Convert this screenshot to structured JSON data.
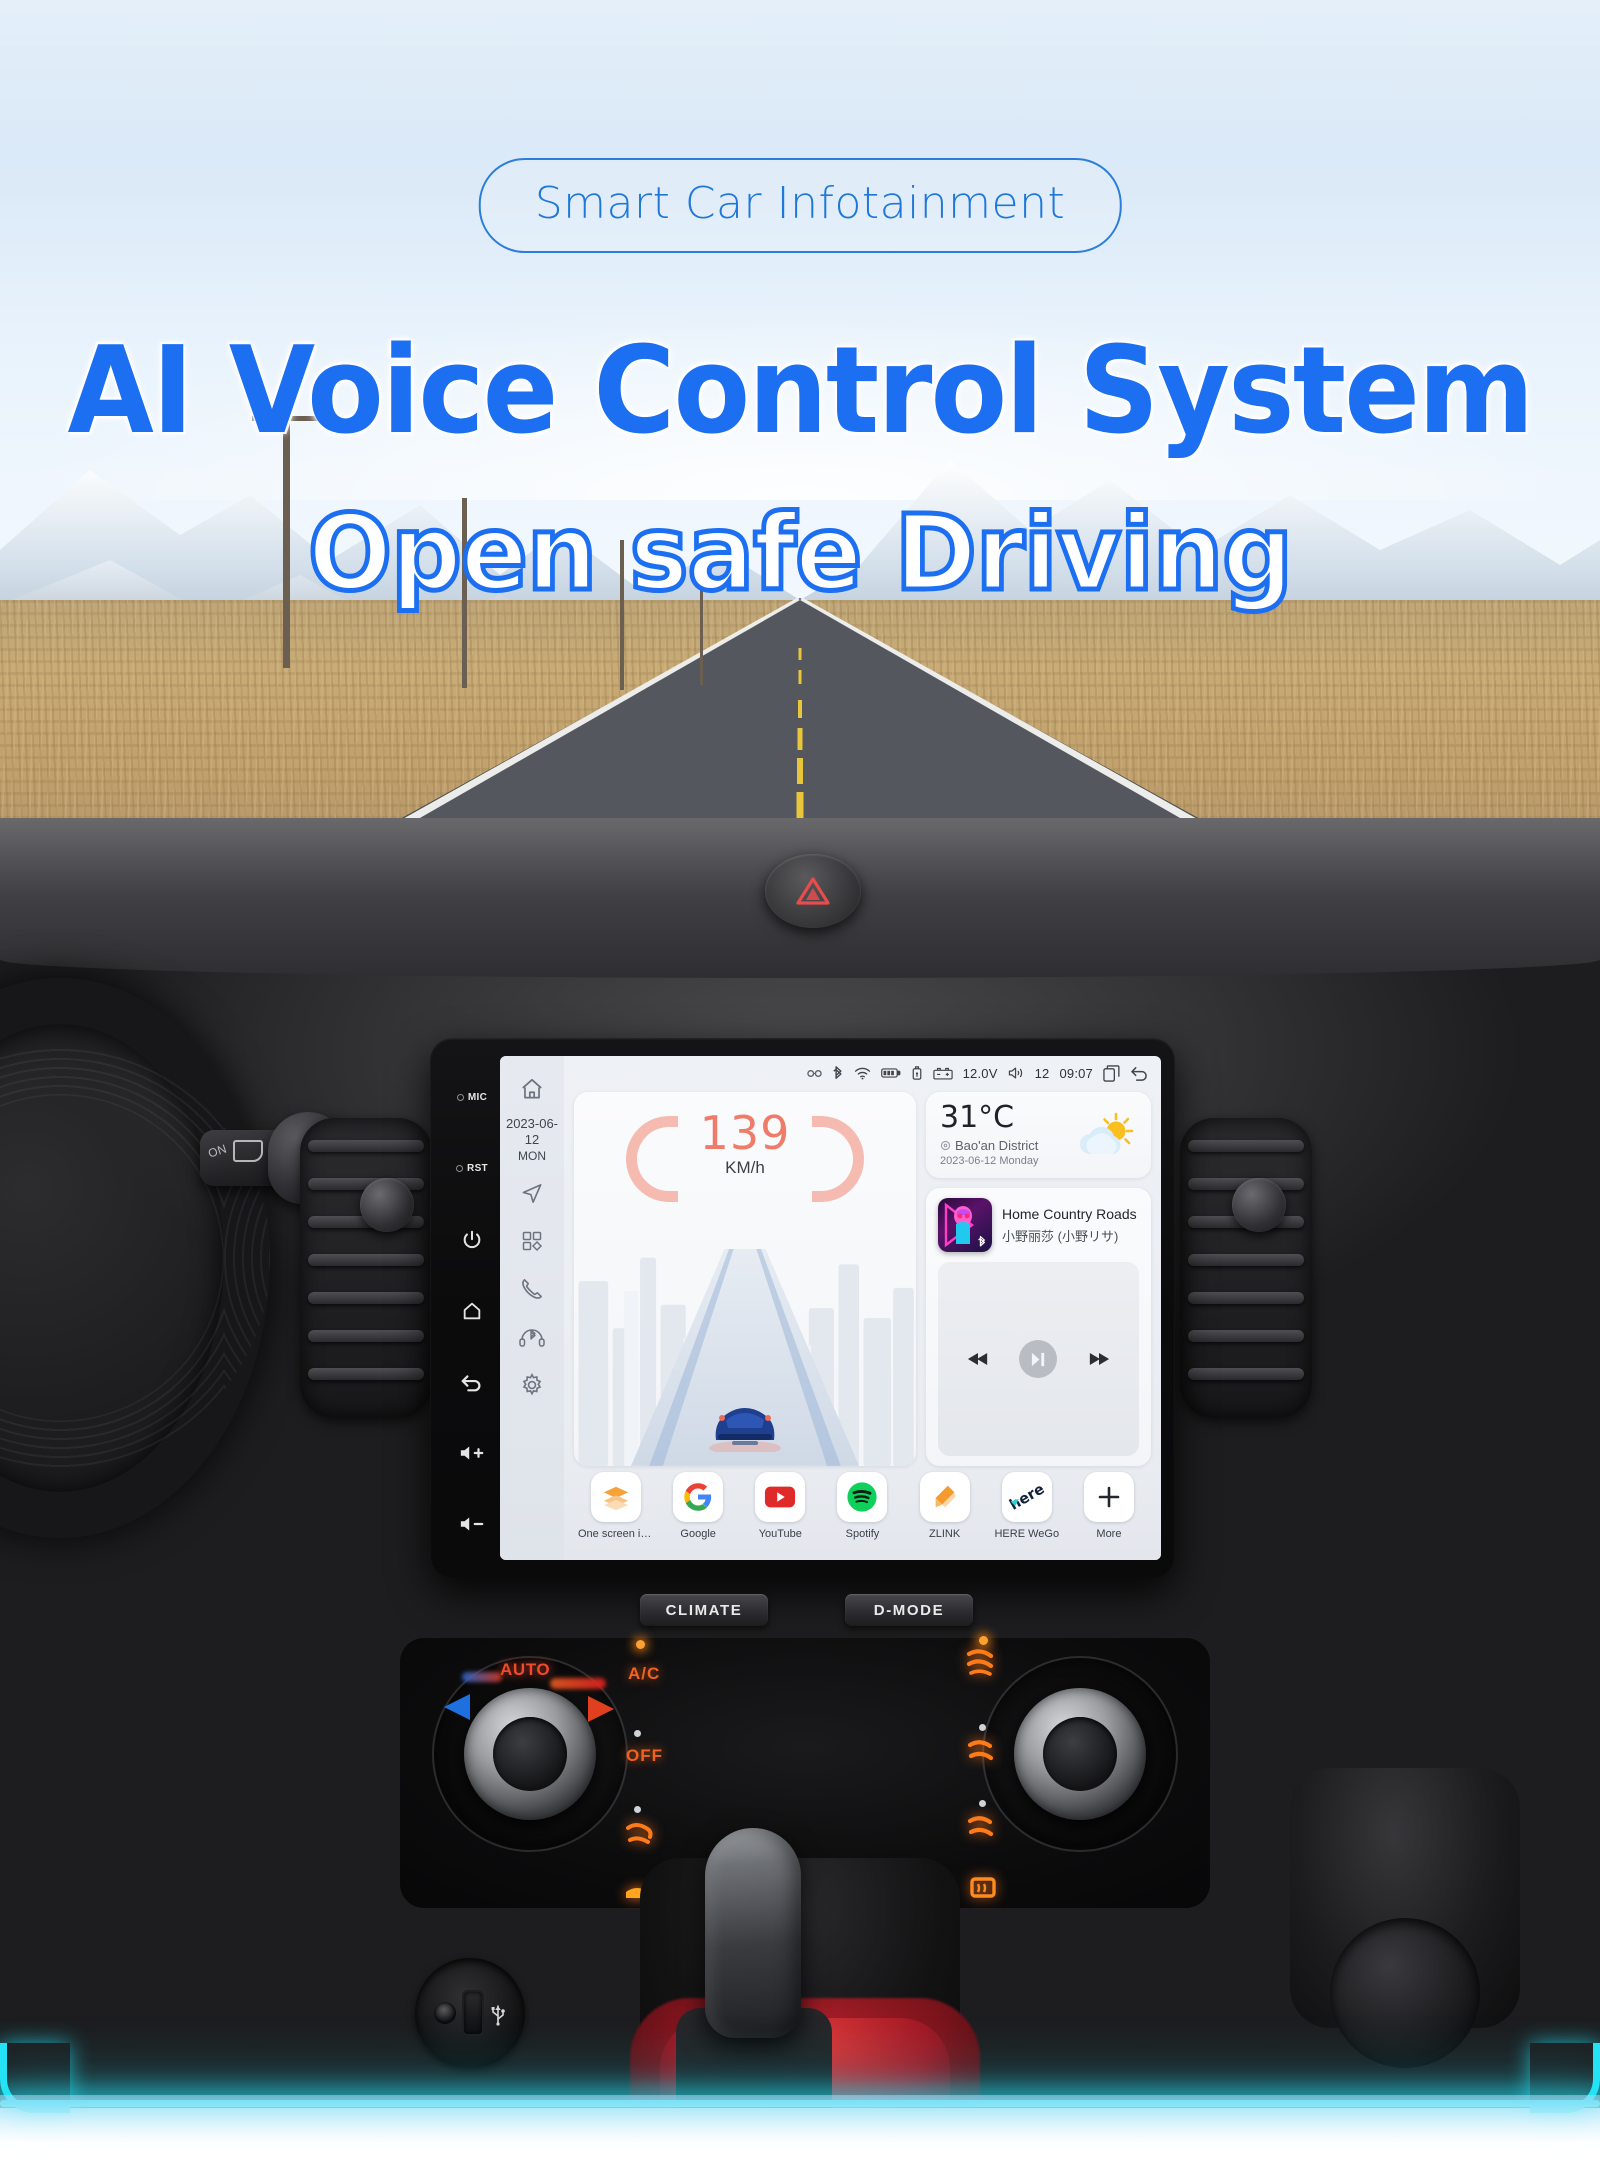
{
  "hero": {
    "badge": "Smart Car Infotainment",
    "headline": "AI Voice Control System",
    "subheadline": "Open safe Driving",
    "accent_color": "#1b6ff0",
    "badge_border_color": "#2b7ddb",
    "glow_color": "#25e3f5"
  },
  "head_unit": {
    "physical_buttons": [
      {
        "name": "mic",
        "label": "MIC"
      },
      {
        "name": "reset",
        "label": "RST"
      },
      {
        "name": "power",
        "label": ""
      },
      {
        "name": "home",
        "label": ""
      },
      {
        "name": "back",
        "label": ""
      },
      {
        "name": "volume-up",
        "label": ""
      },
      {
        "name": "volume-down",
        "label": ""
      }
    ],
    "sidebar": {
      "date": "2023-06-12",
      "day_of_week": "MON",
      "items": [
        {
          "icon": "home-icon",
          "label": "Home"
        },
        {
          "icon": "navigation-icon",
          "label": "Navigation"
        },
        {
          "icon": "apps-grid-icon",
          "label": "Apps"
        },
        {
          "icon": "phone-icon",
          "label": "Phone"
        },
        {
          "icon": "bluetooth-headset-icon",
          "label": "Bluetooth Audio"
        },
        {
          "icon": "settings-gear-icon",
          "label": "Settings"
        }
      ]
    },
    "statusbar": {
      "icons": [
        "link-icon",
        "bluetooth-icon",
        "wifi-icon",
        "battery-icon",
        "usb-icon",
        "car-battery-icon"
      ],
      "voltage": "12.0V",
      "volume_icon": "volume-icon",
      "volume_level": "12",
      "clock": "09:07",
      "recents_icon": "recents-icon",
      "back_icon": "back-arrow-icon"
    },
    "speed_widget": {
      "value": "139",
      "unit": "KM/h",
      "value_color": "#ef7b6a"
    },
    "weather_widget": {
      "temperature": "31°C",
      "location": "Bao'an District",
      "date": "2023-06-12 Monday",
      "condition_icon": "sun-behind-cloud-icon"
    },
    "music_widget": {
      "title": "Home Country Roads",
      "artist": "小野丽莎 (小野リサ)",
      "source_icon": "bluetooth-icon",
      "controls": [
        {
          "name": "previous-track-button",
          "icon": "prev-icon"
        },
        {
          "name": "play-pause-button",
          "icon": "play-pause-icon"
        },
        {
          "name": "next-track-button",
          "icon": "next-icon"
        }
      ]
    },
    "dock": [
      {
        "label": "One screen in...",
        "icon": "layers-icon"
      },
      {
        "label": "Google",
        "icon": "google-icon"
      },
      {
        "label": "YouTube",
        "icon": "youtube-icon"
      },
      {
        "label": "Spotify",
        "icon": "spotify-icon"
      },
      {
        "label": "ZLINK",
        "icon": "zlink-icon"
      },
      {
        "label": "HERE WeGo",
        "icon": "here-wego-icon"
      },
      {
        "label": "More",
        "icon": "plus-icon"
      }
    ]
  },
  "dashboard": {
    "hazard_button": "hazard-triangle-icon",
    "hardware_buttons": [
      {
        "label": "CLIMATE"
      },
      {
        "label": "D-MODE"
      }
    ],
    "climate": {
      "auto_label": "AUTO",
      "ac_label": "A/C",
      "off_label": "OFF",
      "left_knob": "temperature-knob",
      "right_knob": "fan-speed-knob",
      "airflow_icons": [
        "airflow-face-icon",
        "airflow-feet-icon",
        "airflow-face-feet-icon",
        "defrost-icon",
        "rear-defrost-icon"
      ]
    },
    "ports": [
      "aux-port",
      "usb-port"
    ],
    "shifter": "gear-shifter",
    "stalk_label": "ON"
  }
}
